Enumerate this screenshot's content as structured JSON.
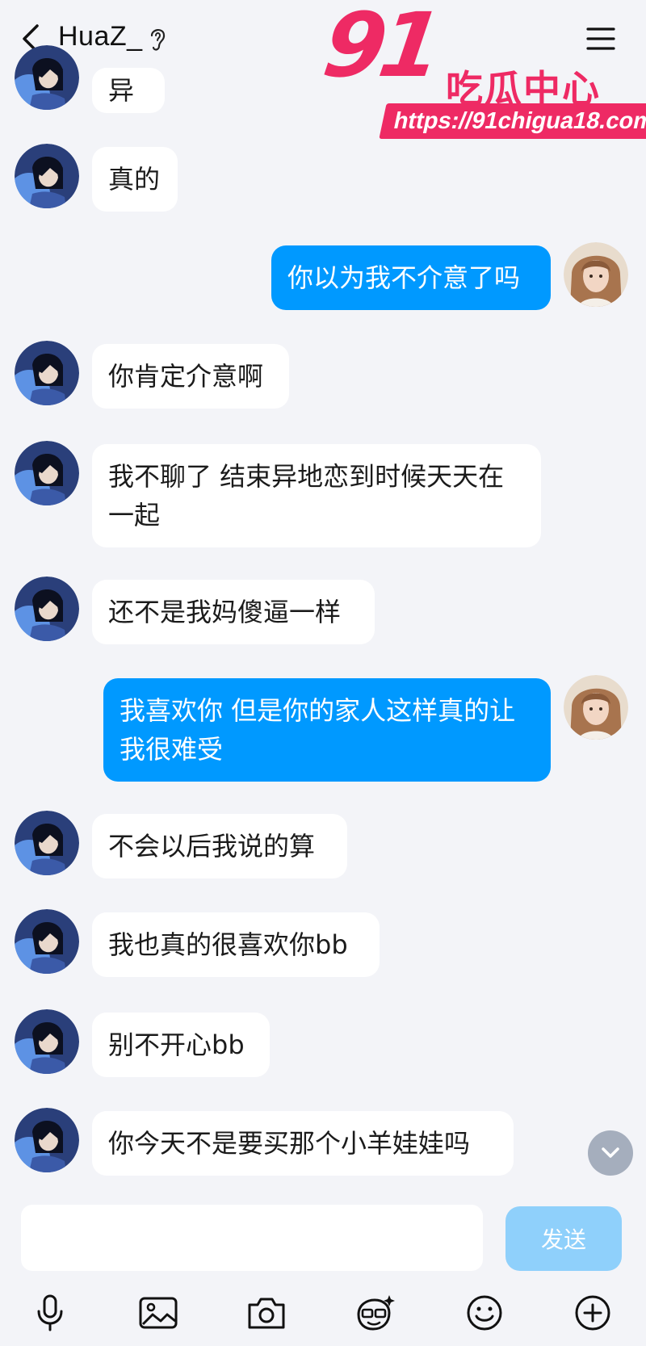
{
  "header": {
    "title": "HuaZ_",
    "back_icon": "back-arrow-icon",
    "status_icon": "ear-icon",
    "menu_icon": "menu-icon"
  },
  "watermark": {
    "number": "91",
    "text": "吃瓜中心",
    "url": "https://91chigua18.com",
    "color": "#ee2a64"
  },
  "messages": [
    {
      "side": "in",
      "text": "异"
    },
    {
      "side": "in",
      "text": "真的"
    },
    {
      "side": "out",
      "text": "你以为我不介意了吗"
    },
    {
      "side": "in",
      "text": "你肯定介意啊"
    },
    {
      "side": "in",
      "text": "我不聊了 结束异地恋到时候天天在一起"
    },
    {
      "side": "in",
      "text": "还不是我妈傻逼一样"
    },
    {
      "side": "out",
      "text": "我喜欢你 但是你的家人这样真的让我很难受"
    },
    {
      "side": "in",
      "text": "不会以后我说的算"
    },
    {
      "side": "in",
      "text": "我也真的很喜欢你bb"
    },
    {
      "side": "in",
      "text": "别不开心bb"
    },
    {
      "side": "in",
      "text": "你今天不是要买那个小羊娃娃吗"
    }
  ],
  "input": {
    "value": "",
    "send_label": "发送"
  },
  "toolbar": [
    "microphone-icon",
    "image-icon",
    "camera-icon",
    "sticker-icon",
    "emoji-icon",
    "plus-icon"
  ],
  "colors": {
    "background": "#f3f4f8",
    "incoming_bubble": "#ffffff",
    "outgoing_bubble": "#0099ff",
    "send_button": "#8fd0fb"
  }
}
